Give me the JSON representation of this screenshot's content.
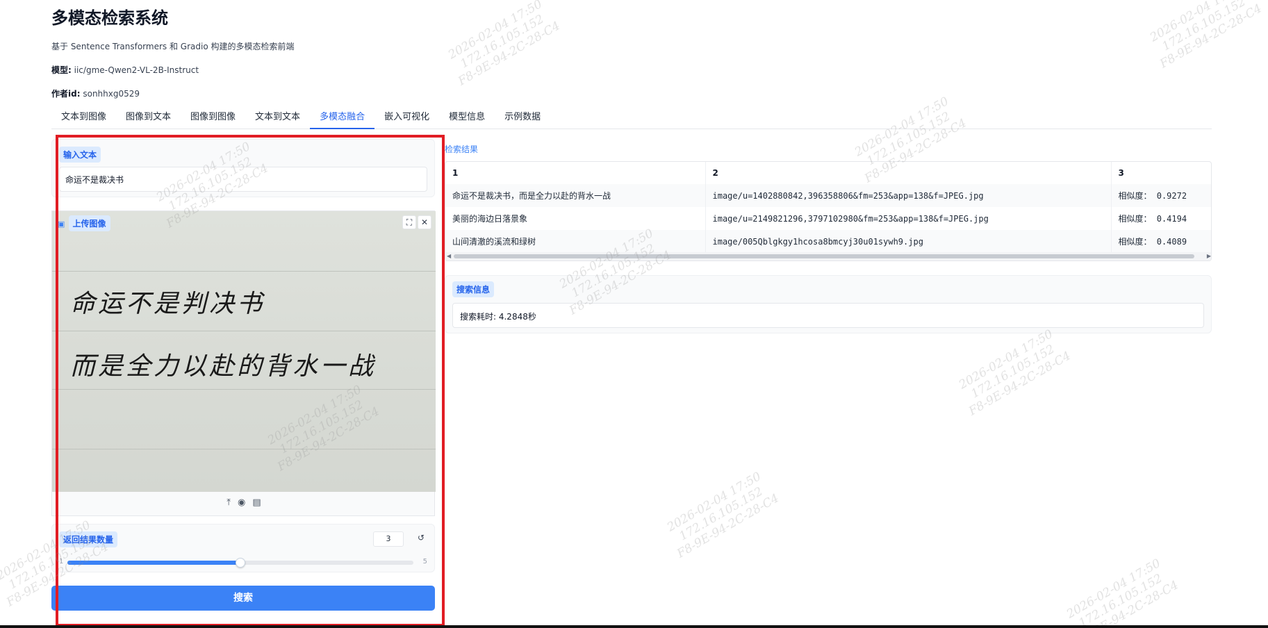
{
  "app": {
    "title": "多模态检索系统",
    "subtitle": "基于 Sentence Transformers 和 Gradio 构建的多模态检索前端",
    "model_label": "模型:",
    "model_value": "iic/gme-Qwen2-VL-2B-Instruct",
    "author_label": "作者id:",
    "author_value": "sonhhxg0529"
  },
  "tabs": [
    "文本到图像",
    "图像到文本",
    "图像到图像",
    "文本到文本",
    "多模态融合",
    "嵌入可视化",
    "模型信息",
    "示例数据"
  ],
  "active_tab": "多模态融合",
  "input_text": {
    "label": "输入文本",
    "value": "命运不是裁决书"
  },
  "upload": {
    "label": "上传图像",
    "handwriting_line1": "命运不是判决书",
    "handwriting_line2": "而是全力以赴的背水一战",
    "expand_icon": "expand-icon",
    "close_icon": "close-icon",
    "bottom_icons": [
      "upload-icon",
      "webcam-icon",
      "clipboard-icon"
    ]
  },
  "slider": {
    "label": "返回结果数量",
    "value": "3",
    "min": "1",
    "max": "5",
    "fraction": 0.5
  },
  "search_button": "搜索",
  "results": {
    "label": "检索结果",
    "headers": [
      "1",
      "2",
      "3"
    ],
    "rows": [
      [
        "命运不是裁决书，而是全力以赴的背水一战",
        "image/u=1402880842,396358806&fm=253&app=138&f=JPEG.jpg",
        "相似度： 0.9272"
      ],
      [
        "美丽的海边日落景象",
        "image/u=2149821296,3797102980&fm=253&app=138&f=JPEG.jpg",
        "相似度： 0.4194"
      ],
      [
        "山间清澈的溪流和绿树",
        "image/005Qblgkgy1hcosa8bmcyj30u01sywh9.jpg",
        "相似度： 0.4089"
      ]
    ]
  },
  "search_info": {
    "label": "搜索信息",
    "value": "搜索耗时: 4.2848秒"
  },
  "watermark": {
    "line1": "2026-02-04 17:50",
    "line2": "172.16.105.152",
    "line3": "F8-9E-94-2C-28-C4"
  },
  "colors": {
    "accent": "#3b82f6",
    "highlight_border": "#e11d24",
    "badge_bg": "#dbeafe"
  }
}
